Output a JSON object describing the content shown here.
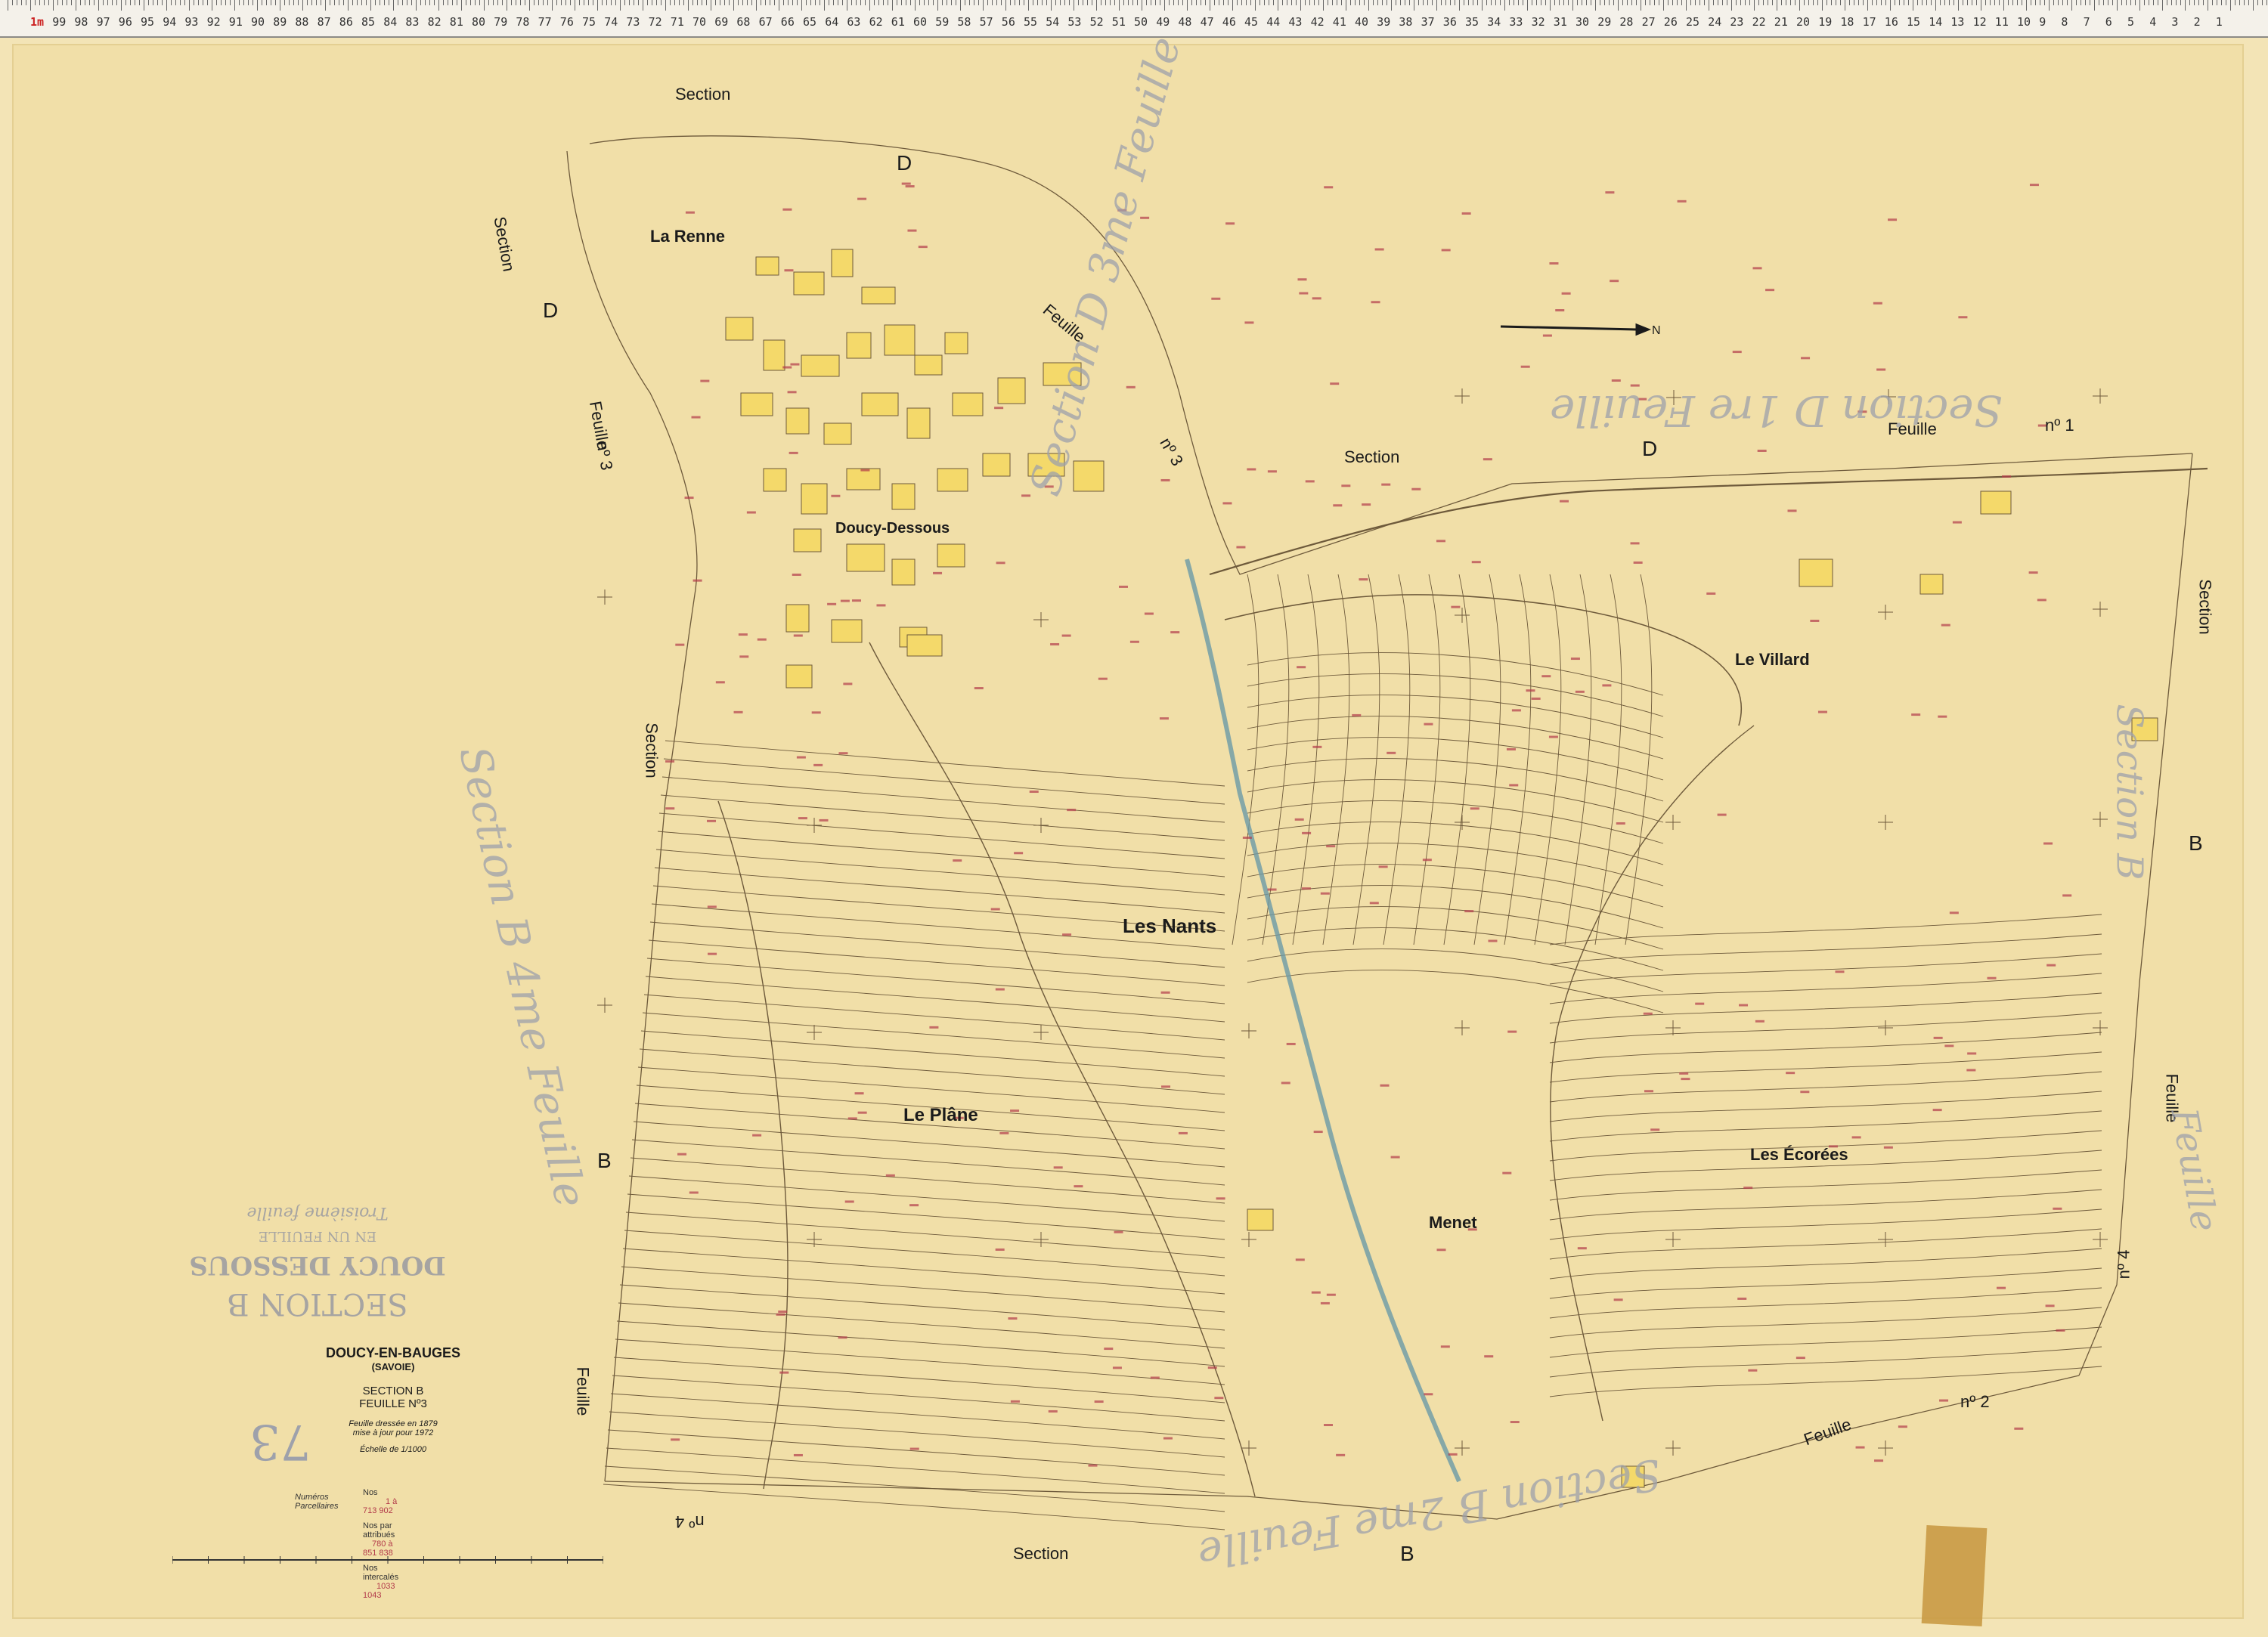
{
  "ruler": {
    "marks": [
      "1m",
      "99",
      "98",
      "97",
      "96",
      "95",
      "94",
      "93",
      "92",
      "91",
      "90",
      "89",
      "88",
      "87",
      "86",
      "85",
      "84",
      "83",
      "82",
      "81",
      "80",
      "79",
      "78",
      "77",
      "76",
      "75",
      "74",
      "73",
      "72",
      "71",
      "70",
      "69",
      "68",
      "67",
      "66",
      "65",
      "64",
      "63",
      "62",
      "61",
      "60",
      "59",
      "58",
      "57",
      "56",
      "55",
      "54",
      "53",
      "52",
      "51",
      "50",
      "49",
      "48",
      "47",
      "46",
      "45",
      "44",
      "43",
      "42",
      "41",
      "40",
      "39",
      "38",
      "37",
      "36",
      "35",
      "34",
      "33",
      "32",
      "31",
      "30",
      "29",
      "28",
      "27",
      "26",
      "25",
      "24",
      "23",
      "22",
      "21",
      "20",
      "19",
      "18",
      "17",
      "16",
      "15",
      "14",
      "13",
      "12",
      "11",
      "10",
      "9",
      "8",
      "7",
      "6",
      "5",
      "4",
      "3",
      "2",
      "1"
    ]
  },
  "places": {
    "la_renne": "La Renne",
    "doucy_dessous": "Doucy-Dessous",
    "le_villard": "Le Villard",
    "les_nants": "Les Nants",
    "le_plane": "Le Plâne",
    "les_ecorees": "Les Écorées",
    "menet": "Menet"
  },
  "sections": {
    "section": "Section",
    "feuille": "Feuille",
    "D": "D",
    "B": "B",
    "no1": "nº 1",
    "no2": "nº 2",
    "no3": "nº 3",
    "no4": "nº 4"
  },
  "ghost_labels": {
    "d3": "Section D 3me Feuille",
    "d1": "Section D 1re Feuille",
    "b4": "Section B 4me Feuille",
    "b2": "Section B 2me Feuille",
    "b_east": "Section B",
    "b_east_feuille": "Feuille"
  },
  "stamp": {
    "line1": "SECTION B",
    "line2": "DOUCY DESSOUS",
    "line3": "EN UN FEUILLE",
    "line4": "Troisième feuille"
  },
  "title_block": {
    "commune": "DOUCY-EN-BAUGES",
    "dept": "(SAVOIE)",
    "section": "SECTION B",
    "feuille": "FEUILLE Nº3",
    "dressee": "Feuille dressée en 1879",
    "mise_a_jour": "mise à jour pour 1972",
    "echelle": "Échelle de 1/1000",
    "number": "73"
  },
  "legend": {
    "heading": "Numéros Parcellaires",
    "rows": [
      "Nos",
      "Nos par attribués",
      "Nos intercalés"
    ],
    "values": [
      "1 à 713  902",
      "780 à 851  838",
      "1033  1043"
    ]
  },
  "north_label": "N",
  "colors": {
    "paper": "#f1dfa8",
    "parcel_line": "#6e5a3b",
    "built": "#f4d96a",
    "stream": "#6c9aa6",
    "ink": "#1b1b1b",
    "ghost": "#9ea1ab",
    "parcel_number": "#b23a4a"
  }
}
